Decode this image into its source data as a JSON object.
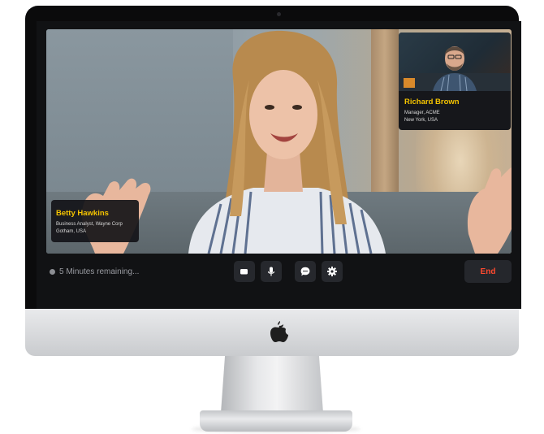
{
  "device": {
    "brand_logo_icon": "apple-logo-icon"
  },
  "call": {
    "main_participant": {
      "name": "Betty Hawkins",
      "role": "Business Analyst, Wayne Corp",
      "location": "Gotham, USA"
    },
    "thumbnail_participant": {
      "name": "Richard Brown",
      "role": "Manager, ACME",
      "location": "New York, USA"
    }
  },
  "controls": {
    "timer_text": "5 Minutes remaining...",
    "buttons": [
      {
        "name": "camera",
        "icon": "video-camera-icon"
      },
      {
        "name": "microphone",
        "icon": "microphone-icon"
      },
      {
        "name": "chat",
        "icon": "chat-bubble-icon"
      },
      {
        "name": "settings",
        "icon": "gear-icon"
      }
    ],
    "end_label": "End"
  },
  "colors": {
    "accent_name": "#f5c400",
    "end_text": "#ff4a2f",
    "bar_bg": "#111214",
    "button_bg": "#26282d"
  }
}
